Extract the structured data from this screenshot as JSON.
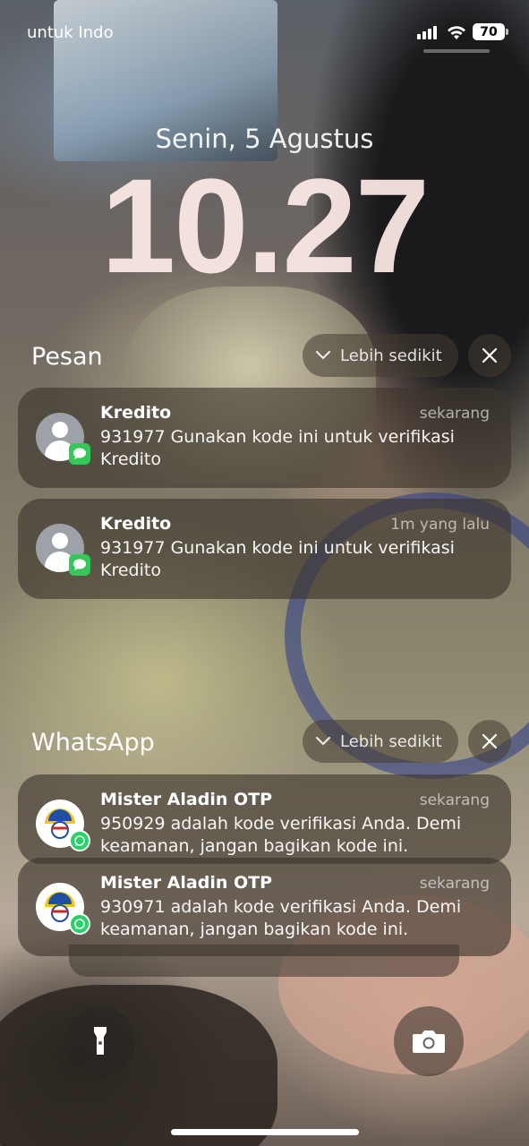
{
  "status_bar": {
    "carrier": "untuk Indo",
    "battery": "70"
  },
  "lock": {
    "date": "Senin, 5 Agustus",
    "time": "10.27"
  },
  "groups": [
    {
      "title": "Pesan",
      "less_label": "Lebih sedikit",
      "notifications": [
        {
          "sender": "Kredito",
          "time": "sekarang",
          "message": "931977 Gunakan kode ini untuk verifikasi Kredito"
        },
        {
          "sender": "Kredito",
          "time": "1m yang lalu",
          "message": "931977 Gunakan kode ini untuk verifikasi Kredito"
        }
      ]
    },
    {
      "title": "WhatsApp",
      "less_label": "Lebih sedikit",
      "notifications": [
        {
          "sender": "Mister Aladin OTP",
          "time": "sekarang",
          "message": "950929 adalah kode verifikasi Anda. Demi keamanan, jangan bagikan kode ini."
        },
        {
          "sender": "Mister Aladin OTP",
          "time": "sekarang",
          "message": "930971 adalah kode verifikasi Anda. Demi keamanan, jangan bagikan kode ini."
        }
      ]
    }
  ],
  "icons": {
    "flashlight": "flashlight-icon",
    "camera": "camera-icon",
    "messages_badge": "messages-app-icon",
    "whatsapp_badge": "whatsapp-app-icon"
  },
  "colors": {
    "messages_green": "#34c759",
    "whatsapp_green": "#25d366",
    "card_bg": "rgba(60,52,44,0.62)"
  }
}
